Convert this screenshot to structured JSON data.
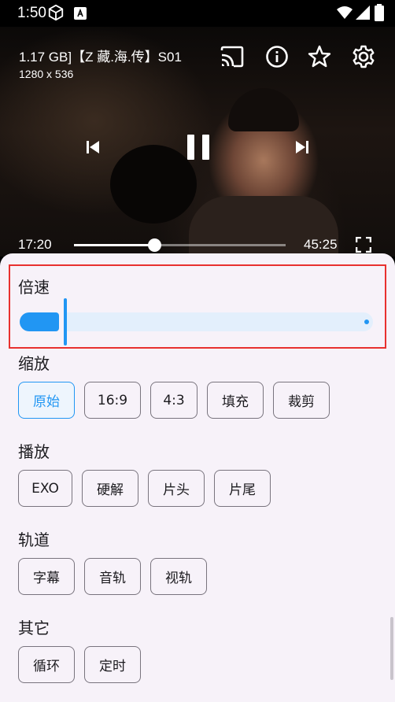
{
  "status_bar": {
    "time": "1:50",
    "icons": [
      "cube-icon",
      "a-badge-icon",
      "wifi-icon",
      "signal-icon",
      "battery-icon"
    ]
  },
  "player": {
    "title": "1.17 GB]【Z 藏.海.传】S01",
    "resolution": "1280 x 536",
    "current_time": "17:20",
    "total_time": "45:25",
    "progress": 0.38,
    "top_icons": [
      "cast-icon",
      "info-icon",
      "star-icon",
      "gear-icon"
    ],
    "controls": [
      "skip-previous-icon",
      "pause-icon",
      "skip-next-icon",
      "fullscreen-icon"
    ]
  },
  "settings": {
    "speed": {
      "label": "倍速",
      "level": 0.13
    },
    "zoom": {
      "label": "缩放",
      "options": [
        "原始",
        "16:9",
        "4:3",
        "填充",
        "裁剪"
      ],
      "selected": "原始"
    },
    "playback": {
      "label": "播放",
      "options": [
        "EXO",
        "硬解",
        "片头",
        "片尾"
      ]
    },
    "tracks": {
      "label": "轨道",
      "options": [
        "字幕",
        "音轨",
        "视轨"
      ]
    },
    "other": {
      "label": "其它",
      "options": [
        "循环",
        "定时"
      ]
    }
  },
  "colors": {
    "accent": "#2196f3",
    "highlight_border": "#e8312f",
    "sheet_background": "#f7f2f9"
  }
}
